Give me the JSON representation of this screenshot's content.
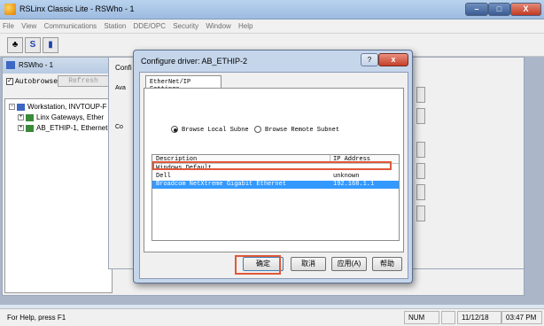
{
  "app": {
    "title": "RSLinx Classic Lite - RSWho - 1",
    "menu": [
      "File",
      "View",
      "Communications",
      "Station",
      "DDE/OPC",
      "Security",
      "Window",
      "Help"
    ],
    "controls": {
      "minimize": "–",
      "maximize": "□",
      "close": "X"
    }
  },
  "toolbar": {
    "buttons": [
      {
        "icon": "network-icon",
        "glyph": "♣"
      },
      {
        "icon": "driver-icon",
        "glyph": "S"
      },
      {
        "icon": "book-icon",
        "glyph": "▮"
      }
    ]
  },
  "rswho": {
    "title": "RSWho - 1",
    "autobrowse_label": "Autobrowse",
    "refresh_label": "Refresh",
    "tree": [
      {
        "label": "Workstation, INVTOUP-F",
        "expanded": true
      },
      {
        "label": "Linx Gateways, Ether",
        "expanded": false
      },
      {
        "label": "AB_ETHIP-1, Ethernet",
        "expanded": false
      }
    ]
  },
  "configure_bg": {
    "title_fragment": "Confi",
    "partial_labels": [
      "Ava",
      "Co"
    ]
  },
  "dialog": {
    "title": "Configure driver: AB_ETHIP-2",
    "help_glyph": "?",
    "close_glyph": "x",
    "tab_label": "EtherNet/IP Settings",
    "radio_local": "Browse Local Subne",
    "radio_remote": "Browse Remote Subnet",
    "list": {
      "columns": [
        "Description",
        "IP Address"
      ],
      "rows": [
        {
          "desc": "Windows Default",
          "ip": ""
        },
        {
          "desc": "Dell",
          "ip": "unknown"
        },
        {
          "desc": "Broadcom NetXtreme Gigabit Ethernet",
          "ip": "192.168.1.1",
          "selected": true
        }
      ]
    },
    "buttons": {
      "ok": "确定",
      "cancel": "取消",
      "apply": "应用(A)",
      "help": "帮助"
    }
  },
  "status": {
    "text": "For Help, press F1",
    "num": "NUM",
    "date": "11/12/18",
    "time": "03:47 PM"
  }
}
